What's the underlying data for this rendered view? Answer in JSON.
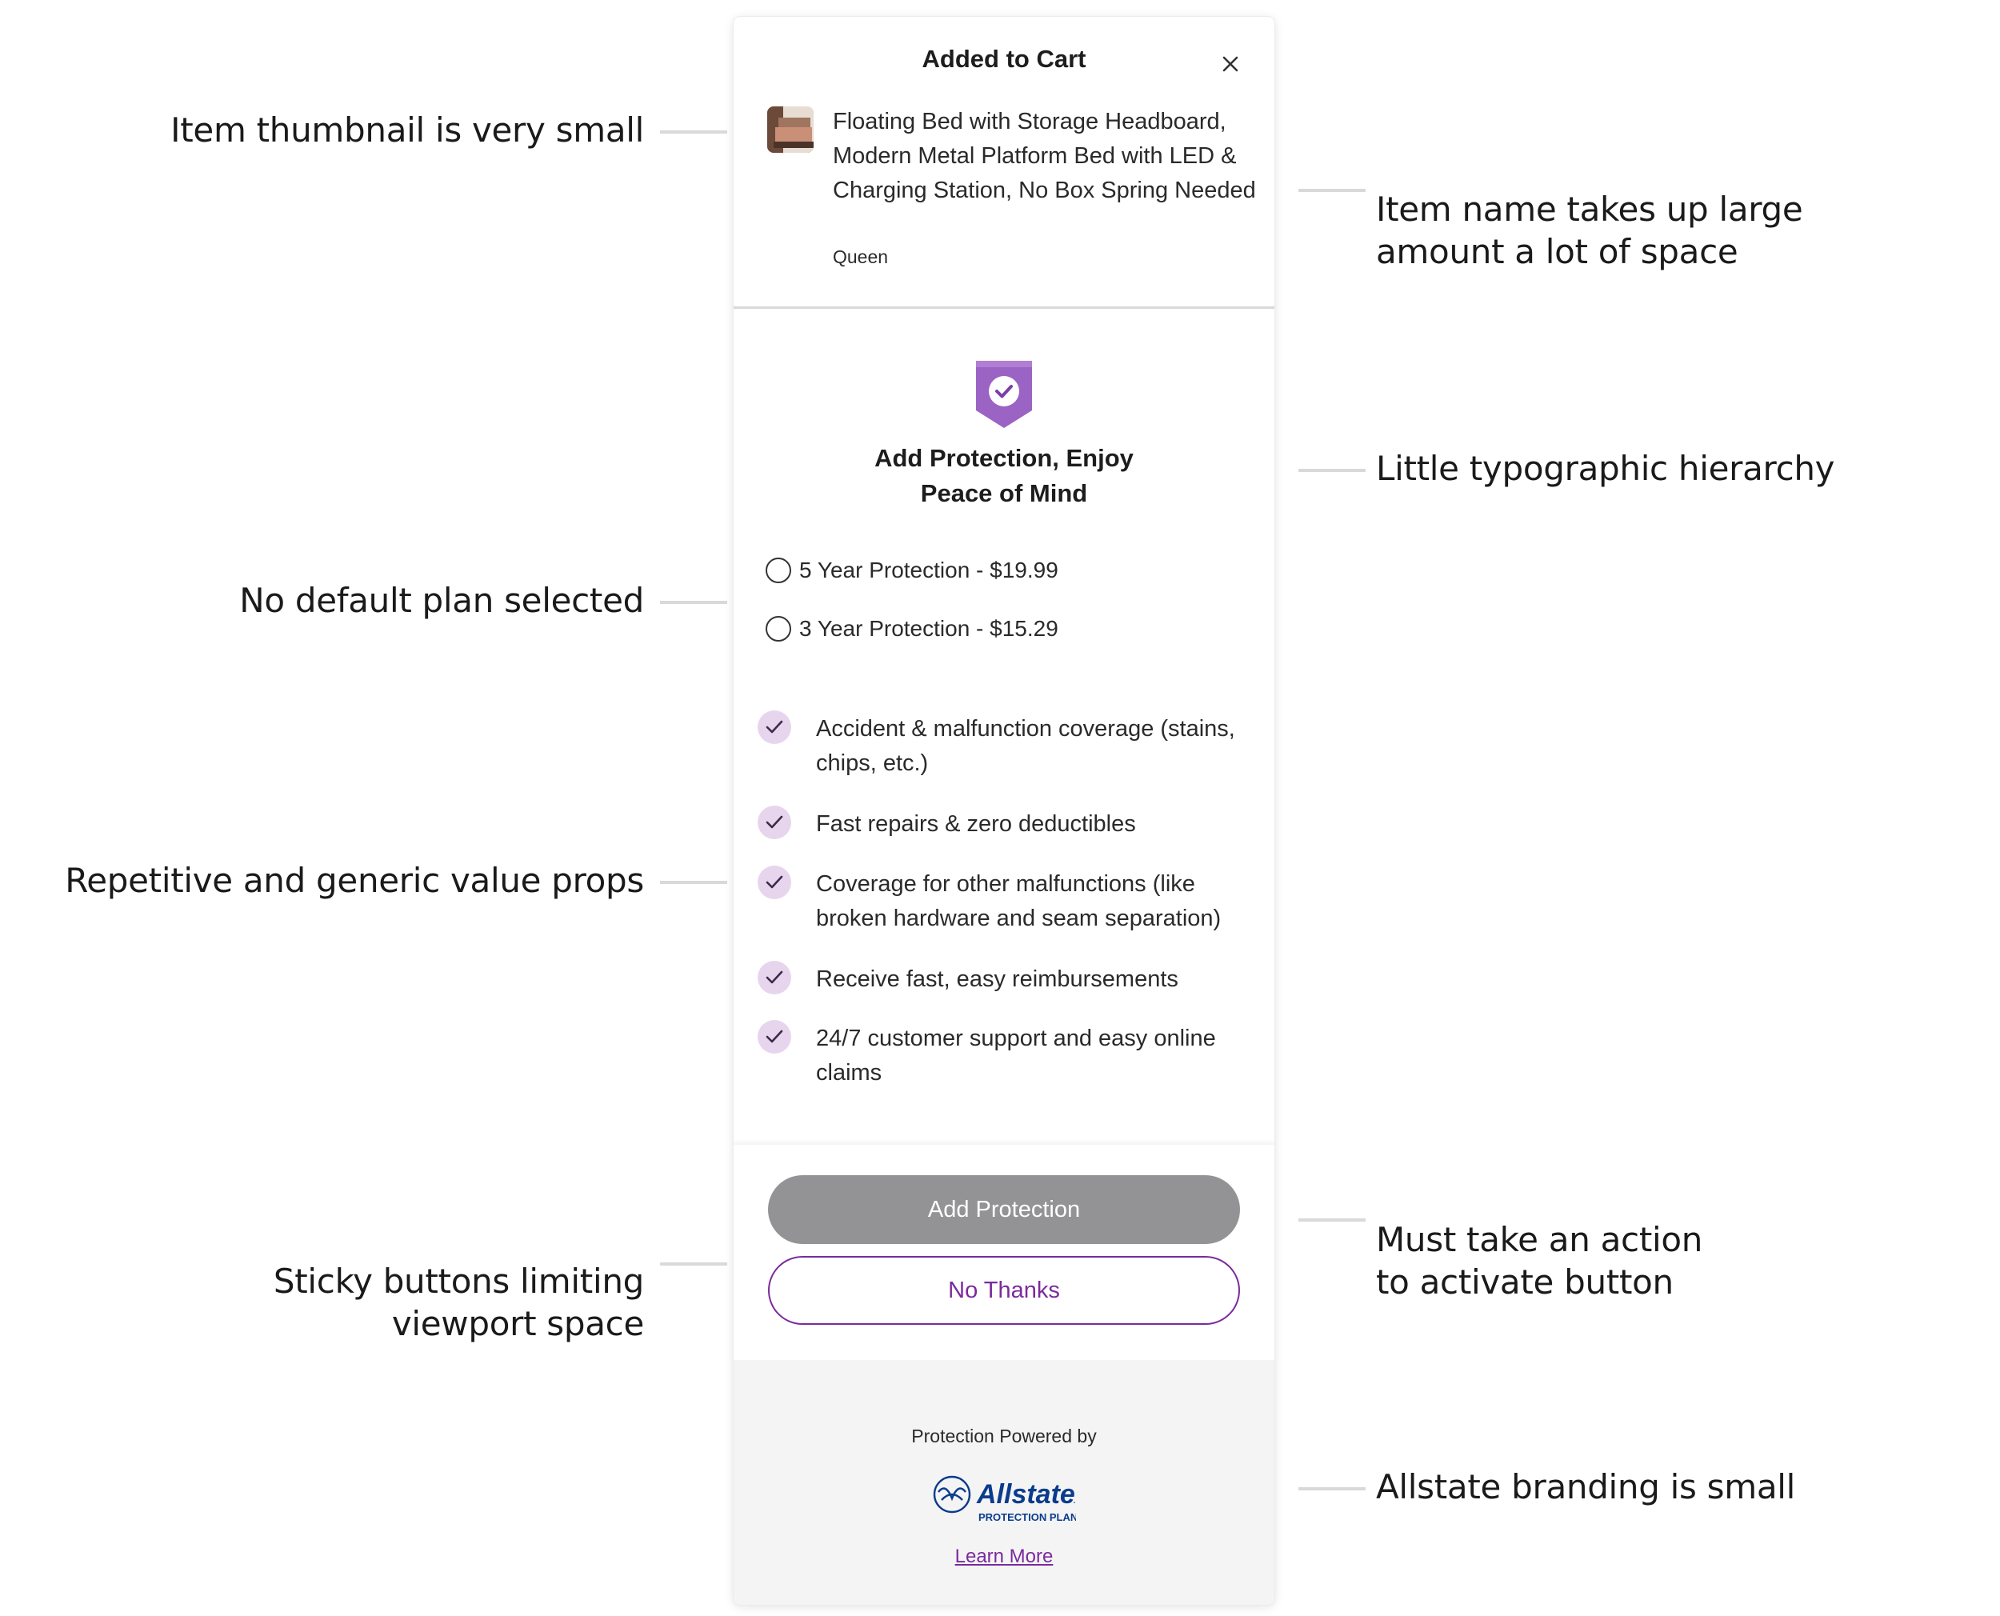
{
  "annotations": {
    "left": [
      "Item thumbnail is very small",
      "No default plan selected",
      "Repetitive and generic value props",
      "Sticky buttons limiting\nviewport space"
    ],
    "right": [
      "Item name takes up large\namount a lot of space",
      "Little typographic hierarchy",
      "Must take an action\nto activate button",
      "Allstate branding is small"
    ]
  },
  "modal": {
    "title": "Added to Cart",
    "close_icon": "close-icon",
    "item": {
      "name": "Floating Bed with Storage Headboard, Modern Metal Platform Bed with LED & Charging Station, No Box Spring Needed",
      "variant": "Queen"
    },
    "protection": {
      "icon": "shield-check-icon",
      "title_line1": "Add Protection, Enjoy",
      "title_line2": "Peace of Mind",
      "plans": [
        {
          "label": "5 Year Protection - $19.99",
          "selected": false
        },
        {
          "label": "3 Year Protection - $15.29",
          "selected": false
        }
      ],
      "benefits": [
        "Accident & malfunction coverage (stains, chips, etc.)",
        "Fast repairs & zero deductibles",
        "Coverage for other malfunctions (like broken hardware and seam separation)",
        "Receive fast, easy reimbursements",
        "24/7 customer support and easy online claims"
      ]
    },
    "actions": {
      "add_label": "Add Protection",
      "add_disabled": true,
      "no_thanks_label": "No Thanks"
    },
    "footer": {
      "powered_by": "Protection Powered by",
      "brand": "Allstate",
      "brand_sub": "PROTECTION PLANS",
      "learn_more": "Learn More"
    }
  },
  "colors": {
    "accent_purple": "#7b2a9d",
    "shield_purple": "#9b63c4",
    "check_bg": "#e7d5ee",
    "disabled_button": "#939396",
    "allstate_blue": "#0b3c8c"
  }
}
